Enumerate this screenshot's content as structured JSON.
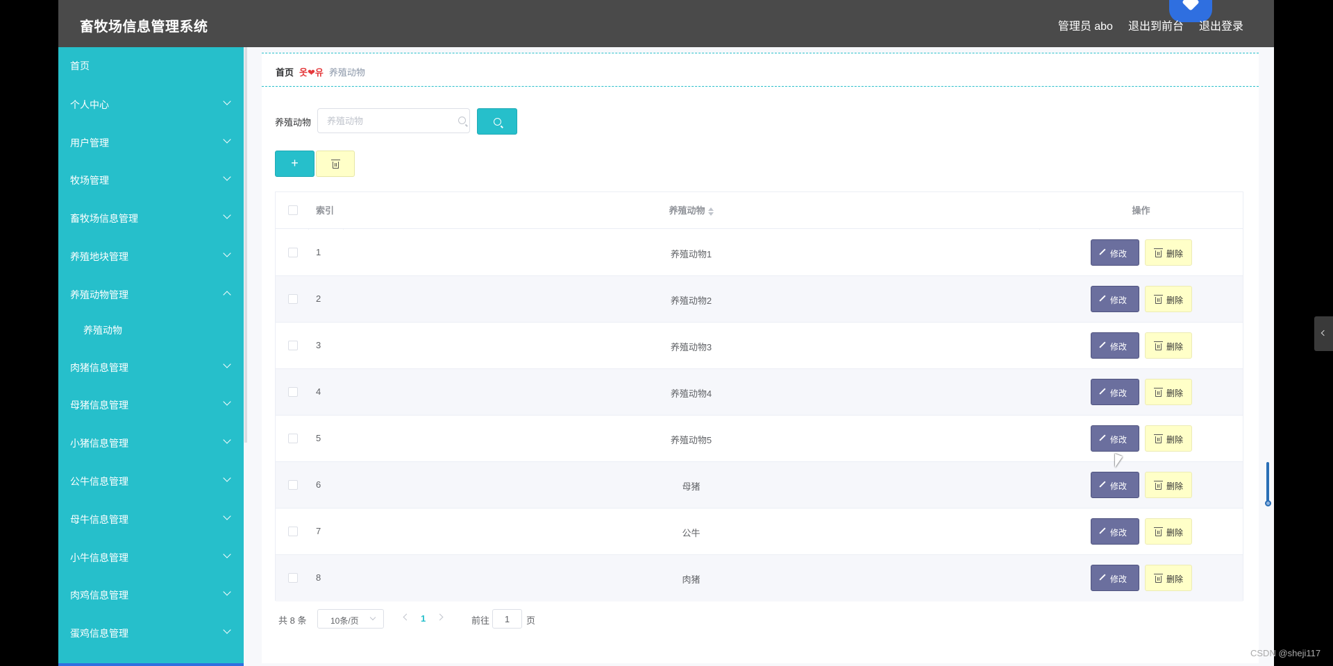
{
  "header": {
    "brand": "畜牧场信息管理系统",
    "user": "管理员 abo",
    "to_front": "退出到前台",
    "logout": "退出登录"
  },
  "sidebar": {
    "home": "首页",
    "items": [
      {
        "label": "个人中心",
        "expanded": false
      },
      {
        "label": "用户管理",
        "expanded": false
      },
      {
        "label": "牧场管理",
        "expanded": false
      },
      {
        "label": "畜牧场信息管理",
        "expanded": false
      },
      {
        "label": "养殖地块管理",
        "expanded": false
      },
      {
        "label": "养殖动物管理",
        "expanded": true
      },
      {
        "label": "肉猪信息管理",
        "expanded": false
      },
      {
        "label": "母猪信息管理",
        "expanded": false
      },
      {
        "label": "小猪信息管理",
        "expanded": false
      },
      {
        "label": "公牛信息管理",
        "expanded": false
      },
      {
        "label": "母牛信息管理",
        "expanded": false
      },
      {
        "label": "小牛信息管理",
        "expanded": false
      },
      {
        "label": "肉鸡信息管理",
        "expanded": false
      },
      {
        "label": "蛋鸡信息管理",
        "expanded": false
      }
    ],
    "sub_item": "养殖动物"
  },
  "breadcrumb": {
    "home": "首页",
    "separator": "옷❤유",
    "current": "养殖动物"
  },
  "search": {
    "label": "养殖动物",
    "placeholder": "养殖动物",
    "value": ""
  },
  "toolbar": {
    "add_label": "+"
  },
  "table": {
    "headers": {
      "index": "索引",
      "animal": "养殖动物",
      "actions": "操作"
    },
    "rows": [
      {
        "index": "1",
        "animal": "养殖动物1"
      },
      {
        "index": "2",
        "animal": "养殖动物2"
      },
      {
        "index": "3",
        "animal": "养殖动物3"
      },
      {
        "index": "4",
        "animal": "养殖动物4"
      },
      {
        "index": "5",
        "animal": "养殖动物5"
      },
      {
        "index": "6",
        "animal": "母猪"
      },
      {
        "index": "7",
        "animal": "公牛"
      },
      {
        "index": "8",
        "animal": "肉猪"
      }
    ],
    "edit_label": "修改",
    "delete_label": "删除"
  },
  "pagination": {
    "total": "共 8 条",
    "page_size": "10条/页",
    "current_page": "1",
    "goto_label": "前往",
    "goto_value": "1",
    "page_suffix": "页"
  },
  "watermark": "CSDN @sheji117",
  "colors": {
    "accent": "#26bfcb",
    "header_bg": "#4a4a4a",
    "edit_button": "#6b6f9e",
    "delete_button": "#ffffc8"
  }
}
